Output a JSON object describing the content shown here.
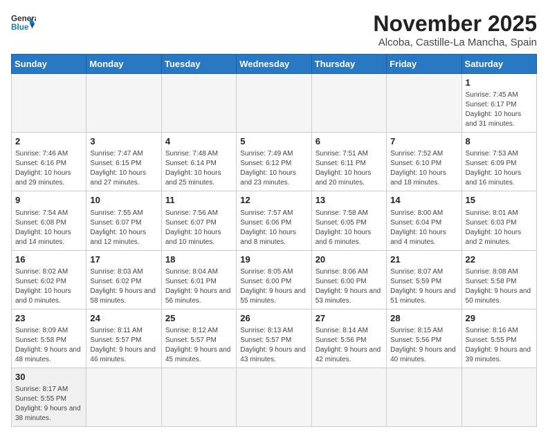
{
  "logo": {
    "general": "General",
    "blue": "Blue"
  },
  "header": {
    "month": "November 2025",
    "location": "Alcoba, Castille-La Mancha, Spain"
  },
  "weekdays": [
    "Sunday",
    "Monday",
    "Tuesday",
    "Wednesday",
    "Thursday",
    "Friday",
    "Saturday"
  ],
  "weeks": [
    [
      {
        "day": "",
        "info": ""
      },
      {
        "day": "",
        "info": ""
      },
      {
        "day": "",
        "info": ""
      },
      {
        "day": "",
        "info": ""
      },
      {
        "day": "",
        "info": ""
      },
      {
        "day": "",
        "info": ""
      },
      {
        "day": "1",
        "info": "Sunrise: 7:45 AM\nSunset: 6:17 PM\nDaylight: 10 hours and 31 minutes."
      }
    ],
    [
      {
        "day": "2",
        "info": "Sunrise: 7:46 AM\nSunset: 6:16 PM\nDaylight: 10 hours and 29 minutes."
      },
      {
        "day": "3",
        "info": "Sunrise: 7:47 AM\nSunset: 6:15 PM\nDaylight: 10 hours and 27 minutes."
      },
      {
        "day": "4",
        "info": "Sunrise: 7:48 AM\nSunset: 6:14 PM\nDaylight: 10 hours and 25 minutes."
      },
      {
        "day": "5",
        "info": "Sunrise: 7:49 AM\nSunset: 6:12 PM\nDaylight: 10 hours and 23 minutes."
      },
      {
        "day": "6",
        "info": "Sunrise: 7:51 AM\nSunset: 6:11 PM\nDaylight: 10 hours and 20 minutes."
      },
      {
        "day": "7",
        "info": "Sunrise: 7:52 AM\nSunset: 6:10 PM\nDaylight: 10 hours and 18 minutes."
      },
      {
        "day": "8",
        "info": "Sunrise: 7:53 AM\nSunset: 6:09 PM\nDaylight: 10 hours and 16 minutes."
      }
    ],
    [
      {
        "day": "9",
        "info": "Sunrise: 7:54 AM\nSunset: 6:08 PM\nDaylight: 10 hours and 14 minutes."
      },
      {
        "day": "10",
        "info": "Sunrise: 7:55 AM\nSunset: 6:07 PM\nDaylight: 10 hours and 12 minutes."
      },
      {
        "day": "11",
        "info": "Sunrise: 7:56 AM\nSunset: 6:07 PM\nDaylight: 10 hours and 10 minutes."
      },
      {
        "day": "12",
        "info": "Sunrise: 7:57 AM\nSunset: 6:06 PM\nDaylight: 10 hours and 8 minutes."
      },
      {
        "day": "13",
        "info": "Sunrise: 7:58 AM\nSunset: 6:05 PM\nDaylight: 10 hours and 6 minutes."
      },
      {
        "day": "14",
        "info": "Sunrise: 8:00 AM\nSunset: 6:04 PM\nDaylight: 10 hours and 4 minutes."
      },
      {
        "day": "15",
        "info": "Sunrise: 8:01 AM\nSunset: 6:03 PM\nDaylight: 10 hours and 2 minutes."
      }
    ],
    [
      {
        "day": "16",
        "info": "Sunrise: 8:02 AM\nSunset: 6:02 PM\nDaylight: 10 hours and 0 minutes."
      },
      {
        "day": "17",
        "info": "Sunrise: 8:03 AM\nSunset: 6:02 PM\nDaylight: 9 hours and 58 minutes."
      },
      {
        "day": "18",
        "info": "Sunrise: 8:04 AM\nSunset: 6:01 PM\nDaylight: 9 hours and 56 minutes."
      },
      {
        "day": "19",
        "info": "Sunrise: 8:05 AM\nSunset: 6:00 PM\nDaylight: 9 hours and 55 minutes."
      },
      {
        "day": "20",
        "info": "Sunrise: 8:06 AM\nSunset: 6:00 PM\nDaylight: 9 hours and 53 minutes."
      },
      {
        "day": "21",
        "info": "Sunrise: 8:07 AM\nSunset: 5:59 PM\nDaylight: 9 hours and 51 minutes."
      },
      {
        "day": "22",
        "info": "Sunrise: 8:08 AM\nSunset: 5:58 PM\nDaylight: 9 hours and 50 minutes."
      }
    ],
    [
      {
        "day": "23",
        "info": "Sunrise: 8:09 AM\nSunset: 5:58 PM\nDaylight: 9 hours and 48 minutes."
      },
      {
        "day": "24",
        "info": "Sunrise: 8:11 AM\nSunset: 5:57 PM\nDaylight: 9 hours and 46 minutes."
      },
      {
        "day": "25",
        "info": "Sunrise: 8:12 AM\nSunset: 5:57 PM\nDaylight: 9 hours and 45 minutes."
      },
      {
        "day": "26",
        "info": "Sunrise: 8:13 AM\nSunset: 5:57 PM\nDaylight: 9 hours and 43 minutes."
      },
      {
        "day": "27",
        "info": "Sunrise: 8:14 AM\nSunset: 5:56 PM\nDaylight: 9 hours and 42 minutes."
      },
      {
        "day": "28",
        "info": "Sunrise: 8:15 AM\nSunset: 5:56 PM\nDaylight: 9 hours and 40 minutes."
      },
      {
        "day": "29",
        "info": "Sunrise: 8:16 AM\nSunset: 5:55 PM\nDaylight: 9 hours and 39 minutes."
      }
    ],
    [
      {
        "day": "30",
        "info": "Sunrise: 8:17 AM\nSunset: 5:55 PM\nDaylight: 9 hours and 38 minutes."
      },
      {
        "day": "",
        "info": ""
      },
      {
        "day": "",
        "info": ""
      },
      {
        "day": "",
        "info": ""
      },
      {
        "day": "",
        "info": ""
      },
      {
        "day": "",
        "info": ""
      },
      {
        "day": "",
        "info": ""
      }
    ]
  ]
}
